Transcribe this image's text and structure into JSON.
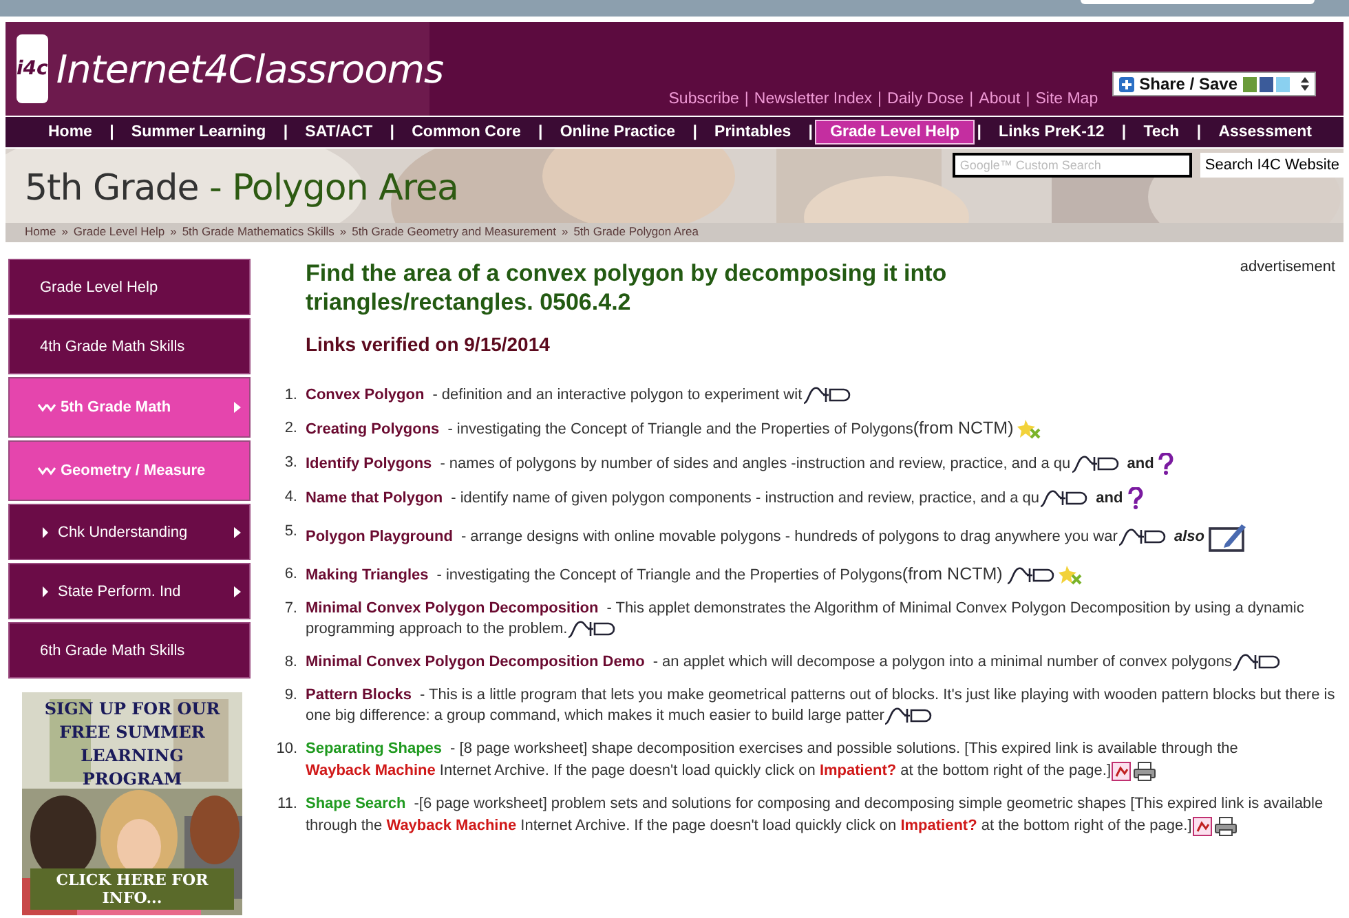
{
  "header": {
    "logo_text": "i4c",
    "site_name": "Internet4Classrooms",
    "separator": "|",
    "links": [
      "Subscribe",
      "Newsletter Index",
      "Daily Dose",
      "About",
      "Site Map"
    ],
    "share_button": "Share / Save"
  },
  "nav": {
    "separator": "|",
    "items": [
      {
        "label": "Home",
        "selected": false
      },
      {
        "label": "Summer Learning",
        "selected": false
      },
      {
        "label": "SAT/ACT",
        "selected": false
      },
      {
        "label": "Common Core",
        "selected": false
      },
      {
        "label": "Online Practice",
        "selected": false
      },
      {
        "label": "Printables",
        "selected": false
      },
      {
        "label": "Grade Level Help",
        "selected": true
      },
      {
        "label": "Links PreK-12",
        "selected": false
      },
      {
        "label": "Tech",
        "selected": false
      },
      {
        "label": "Assessment",
        "selected": false
      }
    ]
  },
  "banner": {
    "title_grade": "5th Grade",
    "title_topic": "- Polygon Area",
    "search": {
      "placeholder": "Google™ Custom Search"
    },
    "search_button": "Search I4C Website",
    "breadcrumb_separator": "»",
    "breadcrumb": [
      "Home",
      "Grade Level Help",
      "5th Grade Mathematics Skills",
      "5th Grade Geometry and Measurement",
      "5th Grade Polygon Area"
    ]
  },
  "sidebar": {
    "items": [
      {
        "label": "Grade Level Help",
        "kind": "plain",
        "selected": false,
        "has_submenu": false
      },
      {
        "label": "4th Grade Math Skills",
        "kind": "plain",
        "selected": false,
        "has_submenu": false
      },
      {
        "label": "5th Grade Math",
        "kind": "open",
        "selected": true,
        "has_submenu": true
      },
      {
        "label": "Geometry / Measure",
        "kind": "open",
        "selected": true,
        "has_submenu": false
      },
      {
        "label": "Chk Understanding",
        "kind": "child",
        "selected": false,
        "has_submenu": true
      },
      {
        "label": "State Perform. Ind",
        "kind": "child",
        "selected": false,
        "has_submenu": true
      },
      {
        "label": "6th Grade Math Skills",
        "kind": "plain",
        "selected": false,
        "has_submenu": false
      }
    ],
    "ad": {
      "kind": "picture",
      "headline": "SIGN UP FOR OUR FREE SUMMER LEARNING PROGRAM",
      "call_to_action": "CLICK HERE FOR INFO..."
    }
  },
  "content": {
    "heading": "Find the area of a convex polygon by decomposing it into triangles/rectangles. 0506.4.2",
    "verified": "Links verified on 9/15/2014",
    "advertisement": "advertisement",
    "items": [
      {
        "number": "1.",
        "title": "Convex Polygon",
        "expired": false,
        "parts": [
          {
            "kind": "text",
            "text": "- definition and an interactive polygon to experiment wit"
          },
          {
            "kind": "applet"
          }
        ]
      },
      {
        "number": "2.",
        "title": "Creating Polygons",
        "expired": false,
        "parts": [
          {
            "kind": "text",
            "text": "- investigating the Concept of Triangle and the Properties of Polygons"
          },
          {
            "kind": "source",
            "text": "(from NCTM)"
          },
          {
            "kind": "nctm"
          }
        ]
      },
      {
        "number": "3.",
        "title": "Identify Polygons",
        "expired": false,
        "parts": [
          {
            "kind": "text",
            "text": "- names of polygons by number of sides and angles -instruction and review, practice, and a qu"
          },
          {
            "kind": "applet"
          },
          {
            "kind": "bold",
            "text": "and"
          },
          {
            "kind": "quiz"
          }
        ]
      },
      {
        "number": "4.",
        "title": "Name that Polygon",
        "expired": false,
        "parts": [
          {
            "kind": "text",
            "text": "- identify name of given polygon components - instruction and review, practice, and a qu"
          },
          {
            "kind": "applet"
          },
          {
            "kind": "bold",
            "text": "and"
          },
          {
            "kind": "quiz"
          }
        ]
      },
      {
        "number": "5.",
        "title": "Polygon Playground",
        "expired": false,
        "parts": [
          {
            "kind": "text",
            "text": "- arrange designs with online movable polygons - hundreds of polygons to drag anywhere you war"
          },
          {
            "kind": "applet"
          },
          {
            "kind": "italic",
            "text": "also"
          },
          {
            "kind": "activity"
          }
        ]
      },
      {
        "number": "6.",
        "title": "Making Triangles",
        "expired": false,
        "parts": [
          {
            "kind": "text",
            "text": "- investigating the Concept of Triangle and the Properties of Polygons"
          },
          {
            "kind": "source",
            "text": "(from NCTM)"
          },
          {
            "kind": "applet"
          },
          {
            "kind": "nctm"
          }
        ]
      },
      {
        "number": "7.",
        "title": "Minimal Convex Polygon Decomposition",
        "expired": false,
        "parts": [
          {
            "kind": "text",
            "text": "- This applet demonstrates the Algorithm of Minimal Convex Polygon Decomposition  by using a dynamic programming approach to the problem."
          },
          {
            "kind": "applet"
          }
        ]
      },
      {
        "number": "8.",
        "title": "Minimal Convex Polygon Decomposition Demo",
        "expired": false,
        "parts": [
          {
            "kind": "text",
            "text": "- an applet which will decompose a polygon into a minimal number of convex polygons"
          },
          {
            "kind": "applet"
          }
        ]
      },
      {
        "number": "9.",
        "title": "Pattern Blocks",
        "expired": false,
        "parts": [
          {
            "kind": "text",
            "text": "- This is a little program that lets you make geometrical patterns out of blocks. It's just like playing with wooden pattern blocks but there is one big difference: a group command, which makes it much easier to build large patter"
          },
          {
            "kind": "applet"
          }
        ]
      },
      {
        "number": "10.",
        "title": "Separating Shapes",
        "expired": true,
        "parts": [
          {
            "kind": "text",
            "text": "- [8 page worksheet] shape decomposition exercises and possible solutions. [This expired link is available through the"
          },
          {
            "kind": "link",
            "text": "Wayback Machine"
          },
          {
            "kind": "text",
            "text": "Internet Archive. If the page doesn't load quickly click on"
          },
          {
            "kind": "link",
            "text": "Impatient?"
          },
          {
            "kind": "text",
            "text": "at the bottom right of the page.]"
          },
          {
            "kind": "document"
          },
          {
            "kind": "print"
          }
        ]
      },
      {
        "number": "11.",
        "title": "Shape Search",
        "expired": true,
        "parts": [
          {
            "kind": "text",
            "text": "-[6 page worksheet] problem sets and solutions for composing and decomposing simple geometric shapes [This expired link is available through the"
          },
          {
            "kind": "link",
            "text": "Wayback Machine"
          },
          {
            "kind": "text",
            "text": "Internet Archive. If the page doesn't load quickly click on"
          },
          {
            "kind": "link",
            "text": "Impatient?"
          },
          {
            "kind": "text",
            "text": "at the bottom right of the page.]"
          },
          {
            "kind": "document"
          },
          {
            "kind": "print"
          }
        ]
      }
    ]
  }
}
